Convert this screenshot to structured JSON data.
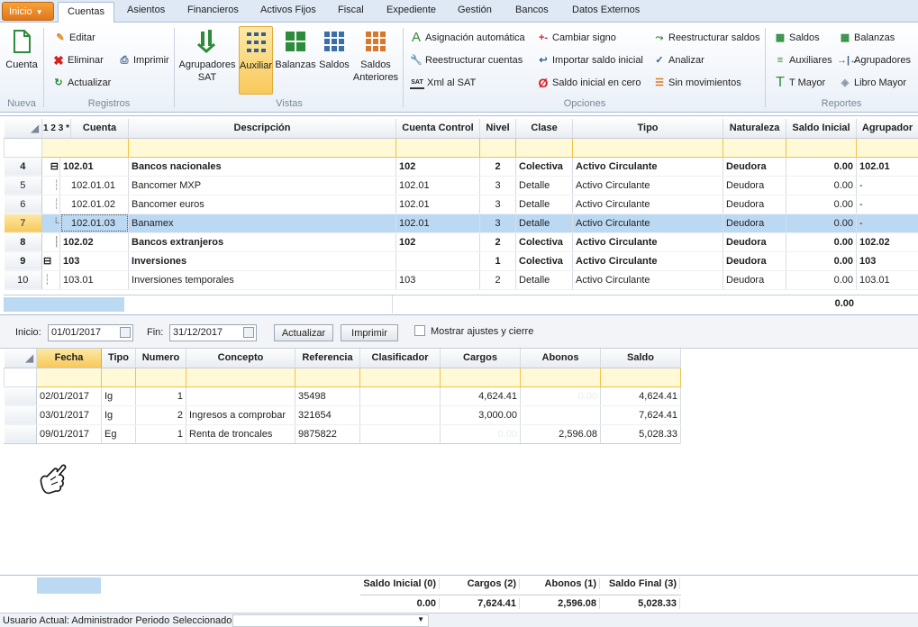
{
  "tabs": {
    "inicio": "Inicio",
    "items": [
      "Cuentas",
      "Asientos",
      "Financieros",
      "Activos Fijos",
      "Fiscal",
      "Expediente",
      "Gestión",
      "Bancos",
      "Datos Externos"
    ]
  },
  "ribbon": {
    "nueva": {
      "label": "Nueva",
      "cuenta": "Cuenta"
    },
    "registros": {
      "label": "Registros",
      "editar": "Editar",
      "eliminar": "Eliminar",
      "imprimir": "Imprimir",
      "actualizar": "Actualizar"
    },
    "vistas": {
      "label": "Vistas",
      "agrupadores_a": "Agrupadores",
      "agrupadores_b": "SAT",
      "auxiliar": "Auxiliar",
      "balanzas": "Balanzas",
      "saldos": "Saldos",
      "saldos_ant_a": "Saldos",
      "saldos_ant_b": "Anteriores"
    },
    "opciones": {
      "label": "Opciones",
      "asignacion": "Asignación automática",
      "reestructurar_cuentas": "Reestructurar cuentas",
      "xml_sat": "Xml al SAT",
      "xml_icon": "SAT",
      "cambiar_signo": "Cambiar signo",
      "importar_saldo": "Importar saldo inicial",
      "saldo_cero": "Saldo inicial en cero",
      "reestructurar_saldos": "Reestructurar saldos",
      "analizar": "Analizar",
      "sin_movimientos": "Sin movimientos"
    },
    "reportes": {
      "label": "Reportes",
      "saldos": "Saldos",
      "auxiliares": "Auxiliares",
      "tmayor": "T Mayor",
      "balanzas": "Balanzas",
      "agrupadores": "Agrupadores",
      "libro_mayor": "Libro Mayor"
    }
  },
  "accounts": {
    "headers": {
      "levels": "1 2 3 *",
      "cuenta": "Cuenta",
      "descripcion": "Descripción",
      "control": "Cuenta Control",
      "nivel": "Nivel",
      "clase": "Clase",
      "tipo": "Tipo",
      "naturaleza": "Naturaleza",
      "saldo": "Saldo Inicial",
      "agrupador": "Agrupador"
    },
    "rows": [
      {
        "n": "4",
        "cuenta": "102.01",
        "desc": "Bancos nacionales",
        "control": "102",
        "nivel": "2",
        "clase": "Colectiva",
        "tipo": "Activo Circulante",
        "nat": "Deudora",
        "saldo": "0.00",
        "agr": "102.01"
      },
      {
        "n": "5",
        "cuenta": "102.01.01",
        "desc": "Bancomer MXP",
        "control": "102.01",
        "nivel": "3",
        "clase": "Detalle",
        "tipo": "Activo Circulante",
        "nat": "Deudora",
        "saldo": "0.00",
        "agr": "-"
      },
      {
        "n": "6",
        "cuenta": "102.01.02",
        "desc": "Bancomer euros",
        "control": "102.01",
        "nivel": "3",
        "clase": "Detalle",
        "tipo": "Activo Circulante",
        "nat": "Deudora",
        "saldo": "0.00",
        "agr": "-"
      },
      {
        "n": "7",
        "cuenta": "102.01.03",
        "desc": "Banamex",
        "control": "102.01",
        "nivel": "3",
        "clase": "Detalle",
        "tipo": "Activo Circulante",
        "nat": "Deudora",
        "saldo": "0.00",
        "agr": "-"
      },
      {
        "n": "8",
        "cuenta": "102.02",
        "desc": "Bancos extranjeros",
        "control": "102",
        "nivel": "2",
        "clase": "Colectiva",
        "tipo": "Activo Circulante",
        "nat": "Deudora",
        "saldo": "0.00",
        "agr": "102.02"
      },
      {
        "n": "9",
        "cuenta": "103",
        "desc": "Inversiones",
        "control": "",
        "nivel": "1",
        "clase": "Colectiva",
        "tipo": "Activo Circulante",
        "nat": "Deudora",
        "saldo": "0.00",
        "agr": "103"
      },
      {
        "n": "10",
        "cuenta": "103.01",
        "desc": "Inversiones temporales",
        "control": "103",
        "nivel": "2",
        "clase": "Detalle",
        "tipo": "Activo Circulante",
        "nat": "Deudora",
        "saldo": "0.00",
        "agr": "103.01"
      }
    ],
    "total": "0.00"
  },
  "filter": {
    "inicio_label": "Inicio:",
    "inicio": "01/01/2017",
    "fin_label": "Fin:",
    "fin": "31/12/2017",
    "actualizar": "Actualizar",
    "imprimir": "Imprimir",
    "mostrar": "Mostrar ajustes y cierre"
  },
  "movements": {
    "headers": {
      "fecha": "Fecha",
      "tipo": "Tipo",
      "numero": "Numero",
      "concepto": "Concepto",
      "referencia": "Referencia",
      "clasificador": "Clasificador",
      "cargos": "Cargos",
      "abonos": "Abonos",
      "saldo": "Saldo"
    },
    "rows": [
      {
        "fecha": "02/01/2017",
        "tipo": "Ig",
        "numero": "1",
        "concepto": "",
        "ref": "35498",
        "clas": "",
        "cargos": "4,624.41",
        "abonos": "0.00",
        "saldo": "4,624.41"
      },
      {
        "fecha": "03/01/2017",
        "tipo": "Ig",
        "numero": "2",
        "concepto": "Ingresos a comprobar",
        "ref": "321654",
        "clas": "",
        "cargos": "3,000.00",
        "abonos": "",
        "saldo": "7,624.41"
      },
      {
        "fecha": "09/01/2017",
        "tipo": "Eg",
        "numero": "1",
        "concepto": "Renta de troncales",
        "ref": "9875822",
        "clas": "",
        "cargos": "0.00",
        "abonos": "2,596.08",
        "saldo": "5,028.33"
      }
    ]
  },
  "summary": {
    "h1": "Saldo Inicial (0)",
    "h2": "Cargos (2)",
    "h3": "Abonos (1)",
    "h4": "Saldo Final (3)",
    "v1": "0.00",
    "v2": "7,624.41",
    "v3": "2,596.08",
    "v4": "5,028.33"
  },
  "status": {
    "text": "Usuario Actual: Administrador  Periodo Seleccionado:"
  }
}
